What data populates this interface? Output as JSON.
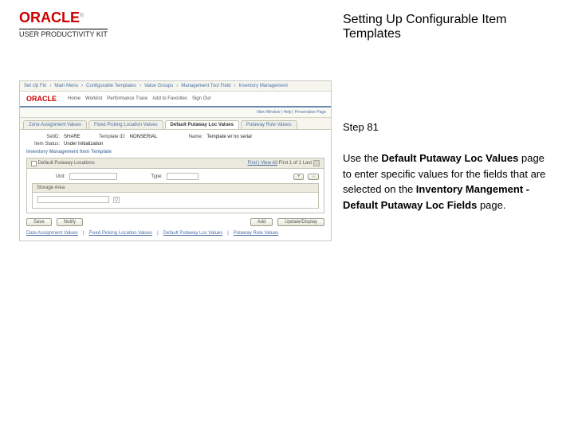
{
  "header": {
    "logo_brand": "ORACLE",
    "logo_reg": "®",
    "logo_subtitle": "USER PRODUCTIVITY KIT",
    "title": "Setting Up Configurable Item Templates"
  },
  "step": {
    "label": "Step 81",
    "text_pre": "Use the ",
    "bold1": "Default Putaway Loc Values",
    "text_mid": " page to enter specific values for the fields that are selected on the ",
    "bold2": "Inventory Mangement - Default Putaway Loc Fields",
    "text_post": " page."
  },
  "app": {
    "crumbs": [
      "Set Up Fin",
      "Main Menu",
      "Configurable Templates",
      "Value Groups",
      "Management Tool Field",
      "Inventory Management"
    ],
    "oracle": "ORACLE",
    "nav_items": [
      "Home",
      "Worklist",
      "Performance Trace",
      "Add to Favorites",
      "Sign Out"
    ],
    "util": "New Window | Help | Personalize Page",
    "tabs": [
      "Zone Assignment Values",
      "Fixed Picking Location Values",
      "Default Putaway Loc Values",
      "Putaway Rule Values"
    ],
    "tab_active_index": 2,
    "f": {
      "setid_lbl": "SetID:",
      "setid": "SHARE",
      "template_lbl": "Template ID:",
      "template": "NONSERIAL",
      "name_lbl": "Name:",
      "name": "Template w/ no serial",
      "status_lbl": "Item Status:",
      "status": "Under Initialization",
      "subheadline": "Inventory Management Item Template"
    },
    "box1": {
      "hdr": "Default Putaway Locations",
      "find": "Find | View All",
      "pager": "First 1 of 1 Last",
      "unit_lbl": "Unit:",
      "unit": "",
      "type_lbl": "Type:"
    },
    "box2": {
      "hdr": "Storage Area",
      "lookup_hint": "Q"
    },
    "save": "Save",
    "notify": "Notify",
    "add": "Add",
    "update": "Update/Display",
    "plus": "+",
    "minus": "−",
    "bottom_links": [
      "Data Assignment Values",
      "Fixed Picking Location Values",
      "Default Putaway Loc Values",
      "Putaway Rule Values"
    ]
  }
}
